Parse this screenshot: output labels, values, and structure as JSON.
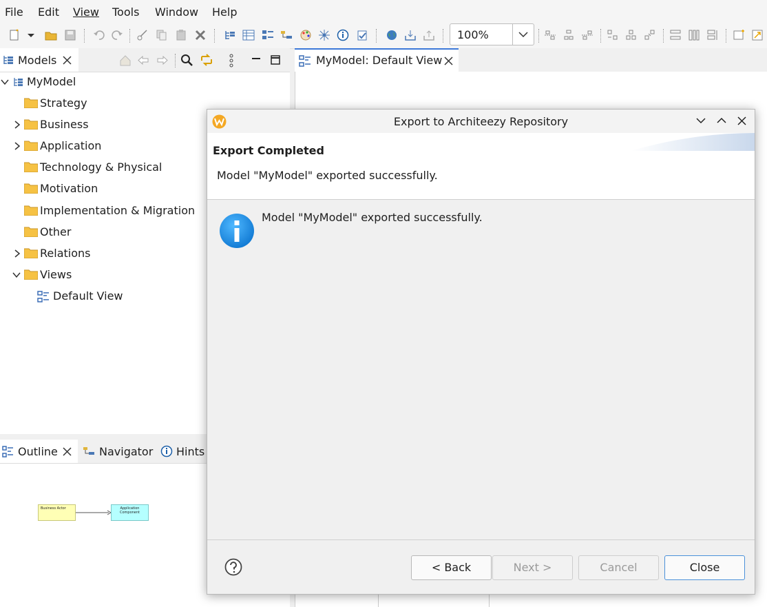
{
  "menu": [
    "File",
    "Edit",
    "View",
    "Tools",
    "Window",
    "Help"
  ],
  "toolbar": {
    "zoom": "100%"
  },
  "models_panel": {
    "tab_label": "Models",
    "tree": {
      "root": "MyModel",
      "folders": [
        {
          "label": "Strategy",
          "expandable": false
        },
        {
          "label": "Business",
          "expandable": true
        },
        {
          "label": "Application",
          "expandable": true
        },
        {
          "label": "Technology & Physical",
          "expandable": false
        },
        {
          "label": "Motivation",
          "expandable": false
        },
        {
          "label": "Implementation & Migration",
          "expandable": false
        },
        {
          "label": "Other",
          "expandable": false
        },
        {
          "label": "Relations",
          "expandable": true
        },
        {
          "label": "Views",
          "expandable": true,
          "expanded": true
        }
      ],
      "view_item": "Default View"
    }
  },
  "editor": {
    "tab_label": "MyModel: Default View"
  },
  "outline_panel": {
    "tabs": [
      "Outline",
      "Navigator",
      "Hints"
    ],
    "diagram": {
      "node1": "Business Actor",
      "node2": "Application Component"
    }
  },
  "dialog": {
    "title": "Export to Architeezy Repository",
    "header_title": "Export Completed",
    "header_message": "Model \"MyModel\" exported successfully.",
    "info_message": "Model \"MyModel\" exported successfully.",
    "buttons": {
      "back": "< Back",
      "next": "Next >",
      "cancel": "Cancel",
      "close": "Close"
    }
  },
  "colors": {
    "accent": "#3c78d8",
    "info_icon": "#1a8fe0",
    "folder": "#f6c244"
  }
}
